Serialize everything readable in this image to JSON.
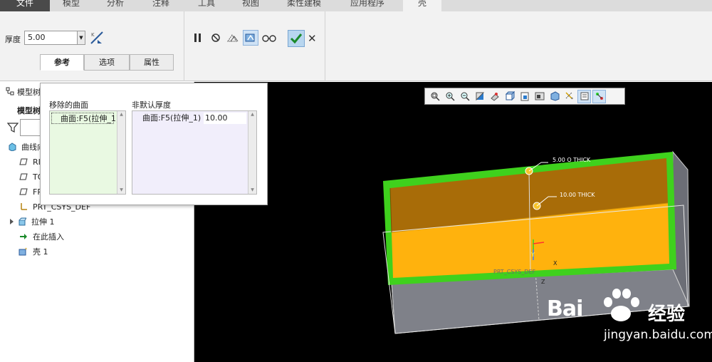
{
  "menu": {
    "tabs": [
      "文件",
      "模型",
      "分析",
      "注释",
      "工具",
      "视图",
      "柔性建模",
      "应用程序",
      "壳"
    ]
  },
  "ribbon": {
    "thickness_label": "厚度",
    "thickness_value": "5.00",
    "subtabs": [
      "参考",
      "选项",
      "属性"
    ]
  },
  "tree": {
    "header": "模型树",
    "subheader": "模型树",
    "items": [
      {
        "label": "曲线向",
        "icon": "part-icon"
      },
      {
        "label": "RIGHT",
        "icon": "datum-plane-icon"
      },
      {
        "label": "TOP",
        "icon": "datum-plane-icon"
      },
      {
        "label": "FRONT",
        "icon": "datum-plane-icon"
      },
      {
        "label": "PRT_CSYS_DEF",
        "icon": "csys-icon"
      },
      {
        "label": "拉伸 1",
        "icon": "extrude-icon"
      },
      {
        "label": "在此插入",
        "icon": "insert-arrow-icon"
      },
      {
        "label": "壳 1",
        "icon": "shell-icon"
      }
    ]
  },
  "popup": {
    "removed_label": "移除的曲面",
    "removed_item": "曲面:F5(拉伸_1)",
    "nondefault_label": "非默认厚度",
    "nondefault_item": "曲面:F5(拉伸_1)",
    "nondefault_value": "10.00"
  },
  "model": {
    "dim1": "5.00  O  THICK",
    "dim2": "10.00  THICK",
    "csys_label": "PRT_CSYS_DEF",
    "axis_y": "Y",
    "axis_x": "X",
    "axis_z": "Z"
  },
  "watermark": {
    "brand": "Bai",
    "brand2": "经验",
    "url": "jingyan.baidu.com"
  },
  "colors": {
    "orange": "#ffb20d",
    "orange_dark": "#a86c08",
    "green": "#3fd11d",
    "gray_box": "#7f8189",
    "accent_blue": "#cfe2f5"
  }
}
